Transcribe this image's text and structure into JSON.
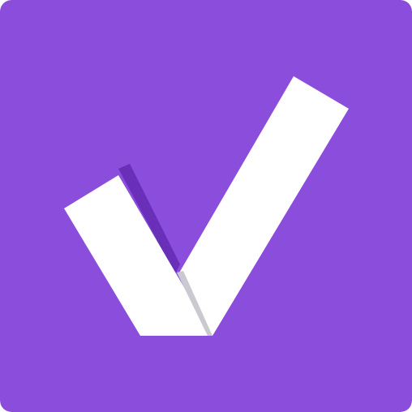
{
  "icon": {
    "name": "checkmark-icon",
    "colors": {
      "background": "#8a4ddc",
      "check": "#ffffff",
      "fold_shadow": "#6a2fb8",
      "fold_crease": "#c9c9cf"
    }
  }
}
